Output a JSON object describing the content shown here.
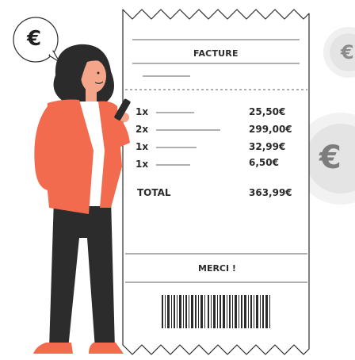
{
  "receipt": {
    "title": "FACTURE",
    "items": [
      {
        "qty": "1x",
        "price": "25,50€"
      },
      {
        "qty": "2x",
        "price": "299,00€"
      },
      {
        "qty": "1x",
        "price": "32,99€"
      },
      {
        "qty": "1x",
        "price": "6,50€"
      }
    ],
    "total_label": "TOTAL",
    "total_value": "363,99€",
    "thanks": "MERCI !"
  },
  "coins": {
    "bubble_symbol": "€",
    "coin_small_symbol": "€",
    "coin_large_symbol": "€"
  },
  "colors": {
    "jacket": "#f26b4f",
    "pants": "#2c2c2c",
    "hair": "#2b2b2b",
    "skin": "#f4a58a",
    "coin": "#e6e6e6"
  }
}
